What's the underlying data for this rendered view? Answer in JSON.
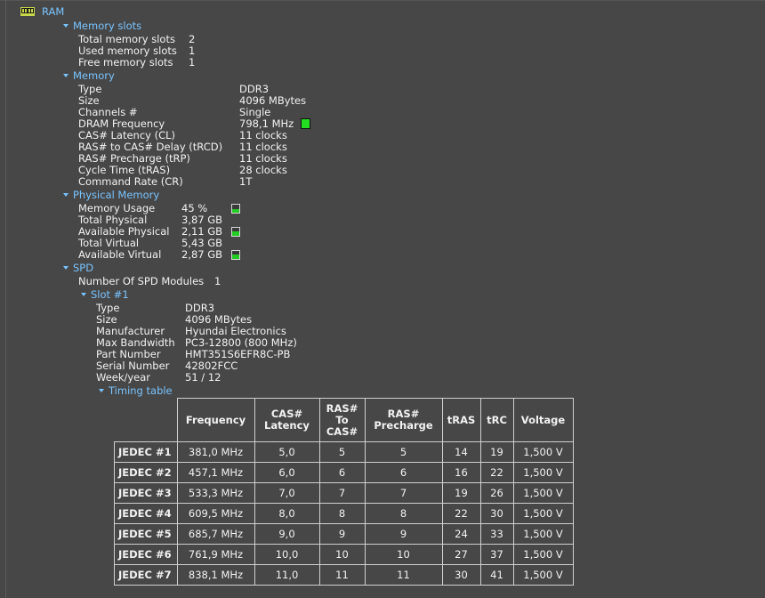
{
  "root": {
    "label": "RAM",
    "icon": "ram-module-icon"
  },
  "memory_slots": {
    "label": "Memory slots",
    "rows": [
      {
        "label": "Total memory slots",
        "value": "2"
      },
      {
        "label": "Used memory slots",
        "value": "1"
      },
      {
        "label": "Free memory slots",
        "value": "1"
      }
    ]
  },
  "memory": {
    "label": "Memory",
    "rows": [
      {
        "label": "Type",
        "value": "DDR3"
      },
      {
        "label": "Size",
        "value": "4096 MBytes"
      },
      {
        "label": "Channels #",
        "value": "Single"
      },
      {
        "label": "DRAM Frequency",
        "value": "798,1 MHz"
      },
      {
        "label": "CAS# Latency (CL)",
        "value": "11 clocks"
      },
      {
        "label": "RAS# to CAS# Delay (tRCD)",
        "value": "11 clocks"
      },
      {
        "label": "RAS# Precharge (tRP)",
        "value": "11 clocks"
      },
      {
        "label": "Cycle Time (tRAS)",
        "value": "28 clocks"
      },
      {
        "label": "Command Rate (CR)",
        "value": "1T"
      }
    ],
    "frequency_indicator_color": "#22dd22"
  },
  "physical_memory": {
    "label": "Physical Memory",
    "rows": [
      {
        "label": "Memory Usage",
        "value": "45 %",
        "fill": 0.45
      },
      {
        "label": "Total Physical",
        "value": "3,87 GB"
      },
      {
        "label": "Available Physical",
        "value": "2,11 GB",
        "fill": 0.55
      },
      {
        "label": "Total Virtual",
        "value": "5,43 GB"
      },
      {
        "label": "Available Virtual",
        "value": "2,87 GB",
        "fill": 0.53
      }
    ]
  },
  "spd": {
    "label": "SPD",
    "modules_label": "Number Of SPD Modules",
    "modules_value": "1",
    "slot": {
      "label": "Slot #1",
      "rows": [
        {
          "label": "Type",
          "value": "DDR3"
        },
        {
          "label": "Size",
          "value": "4096 MBytes"
        },
        {
          "label": "Manufacturer",
          "value": "Hyundai Electronics"
        },
        {
          "label": "Max Bandwidth",
          "value": "PC3-12800 (800 MHz)"
        },
        {
          "label": "Part Number",
          "value": "HMT351S6EFR8C-PB"
        },
        {
          "label": "Serial Number",
          "value": "42802FCC"
        },
        {
          "label": "Week/year",
          "value": "51 / 12"
        }
      ],
      "timing_table": {
        "label": "Timing table",
        "headers": [
          "Frequency",
          "CAS#\nLatency",
          "RAS#\nTo\nCAS#",
          "RAS#\nPrecharge",
          "tRAS",
          "tRC",
          "Voltage"
        ],
        "rows": [
          [
            "JEDEC #1",
            "381,0 MHz",
            "5,0",
            "5",
            "5",
            "14",
            "19",
            "1,500 V"
          ],
          [
            "JEDEC #2",
            "457,1 MHz",
            "6,0",
            "6",
            "6",
            "16",
            "22",
            "1,500 V"
          ],
          [
            "JEDEC #3",
            "533,3 MHz",
            "7,0",
            "7",
            "7",
            "19",
            "26",
            "1,500 V"
          ],
          [
            "JEDEC #4",
            "609,5 MHz",
            "8,0",
            "8",
            "8",
            "22",
            "30",
            "1,500 V"
          ],
          [
            "JEDEC #5",
            "685,7 MHz",
            "9,0",
            "9",
            "9",
            "24",
            "33",
            "1,500 V"
          ],
          [
            "JEDEC #6",
            "761,9 MHz",
            "10,0",
            "10",
            "10",
            "27",
            "37",
            "1,500 V"
          ],
          [
            "JEDEC #7",
            "838,1 MHz",
            "11,0",
            "11",
            "11",
            "30",
            "41",
            "1,500 V"
          ]
        ]
      }
    }
  },
  "colors": {
    "background": "#474747",
    "section_header": "#79c4ff",
    "text": "#f2f2f2",
    "indicator": "#22cc22"
  }
}
